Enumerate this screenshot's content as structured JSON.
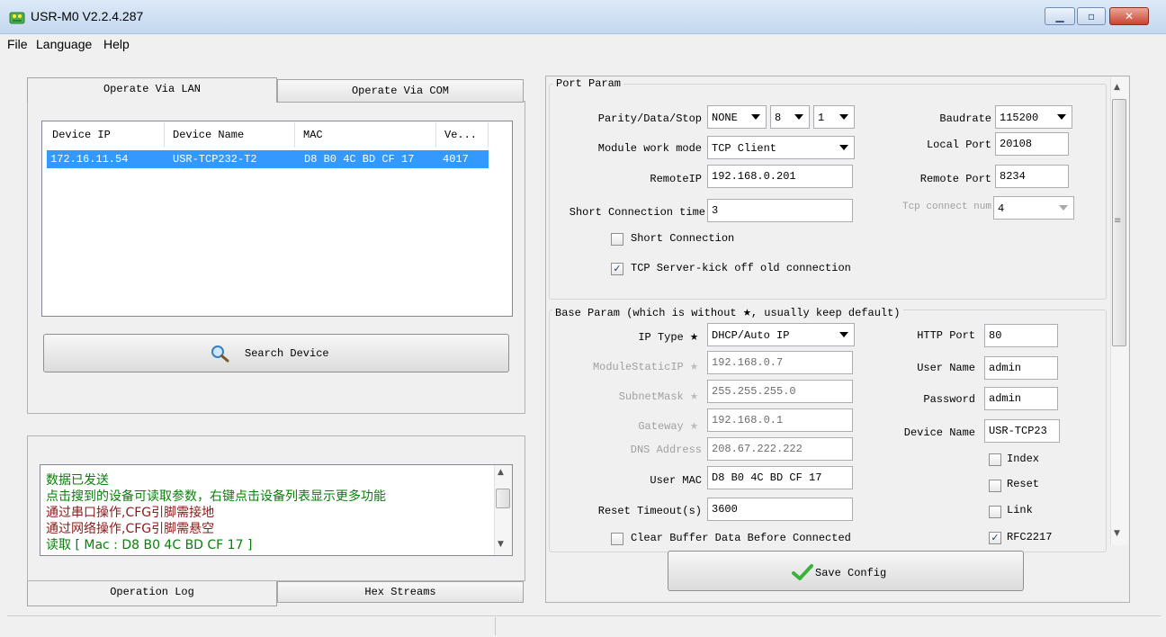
{
  "window": {
    "title": "USR-M0 V2.2.4.287"
  },
  "menu": [
    "File",
    "Language",
    "Help"
  ],
  "left_tabs": {
    "lan": "Operate Via LAN",
    "com": "Operate Via COM"
  },
  "device_table": {
    "headers": [
      "Device IP",
      "Device Name",
      "MAC",
      "Ve..."
    ],
    "rows": [
      {
        "ip": "172.16.11.54",
        "name": "USR-TCP232-T2",
        "mac": "D8 B0 4C BD CF 17",
        "ver": "4017"
      }
    ]
  },
  "search_button": "Search Device",
  "log": {
    "lines": [
      {
        "text": "数据已发送",
        "color": "#0a7f0a"
      },
      {
        "text": "点击搜到的设备可读取参数，右键点击设备列表显示更多功能",
        "color": "#0a7f0a"
      },
      {
        "text": "通过串口操作,CFG引脚需接地",
        "color": "#8b1a1a"
      },
      {
        "text": "通过网络操作,CFG引脚需悬空",
        "color": "#8b1a1a"
      },
      {
        "text": "读取 [ Mac : D8 B0 4C BD CF 17 ]",
        "color": "#0a7f0a"
      }
    ]
  },
  "bottom_tabs": {
    "log": "Operation Log",
    "hex": "Hex Streams"
  },
  "port_param": {
    "group_title": "Port Param",
    "parity_label": "Parity/Data/Stop",
    "parity": "NONE",
    "data_bits": "8",
    "stop_bits": "1",
    "baud_label": "Baudrate",
    "baud": "115200",
    "mode_label": "Module work mode",
    "mode": "TCP Client",
    "local_port_label": "Local Port",
    "local_port": "20108",
    "remote_ip_label": "RemoteIP",
    "remote_ip": "192.168.0.201",
    "remote_port_label": "Remote Port",
    "remote_port": "8234",
    "short_time_label": "Short Connection time",
    "short_time": "3",
    "tcp_num_label": "Tcp connect num",
    "tcp_num": "4",
    "short_conn_label": "Short Connection",
    "short_conn_checked": false,
    "kick_label": "TCP Server-kick off old connection",
    "kick_checked": true
  },
  "base_param": {
    "group_title_a": "Base Param (which is without",
    "group_title_b": ", usually keep default)",
    "ip_type_label": "IP Type",
    "ip_type": "DHCP/Auto IP",
    "static_ip_label": "ModuleStaticIP",
    "static_ip": "192.168.0.7",
    "subnet_label": "SubnetMask",
    "subnet": "255.255.255.0",
    "gateway_label": "Gateway",
    "gateway": "192.168.0.1",
    "dns_label": "DNS Address",
    "dns": "208.67.222.222",
    "mac_label": "User MAC",
    "mac": "D8 B0 4C BD CF 17",
    "reset_timeout_label": "Reset Timeout(s)",
    "reset_timeout": "3600",
    "clear_label": "Clear Buffer Data Before Connected",
    "clear_checked": false,
    "http_port_label": "HTTP Port",
    "http_port": "80",
    "user_label": "User Name",
    "user": "admin",
    "pass_label": "Password",
    "pass": "admin",
    "dev_name_label": "Device Name",
    "dev_name": "USR-TCP23",
    "index_label": "Index",
    "index_checked": false,
    "reset_label": "Reset",
    "reset_checked": false,
    "link_label": "Link",
    "link_checked": false,
    "rfc_label": "RFC2217",
    "rfc_checked": true
  },
  "save_button": "Save Config",
  "star_glyph": "★",
  "check_glyph": "✓"
}
